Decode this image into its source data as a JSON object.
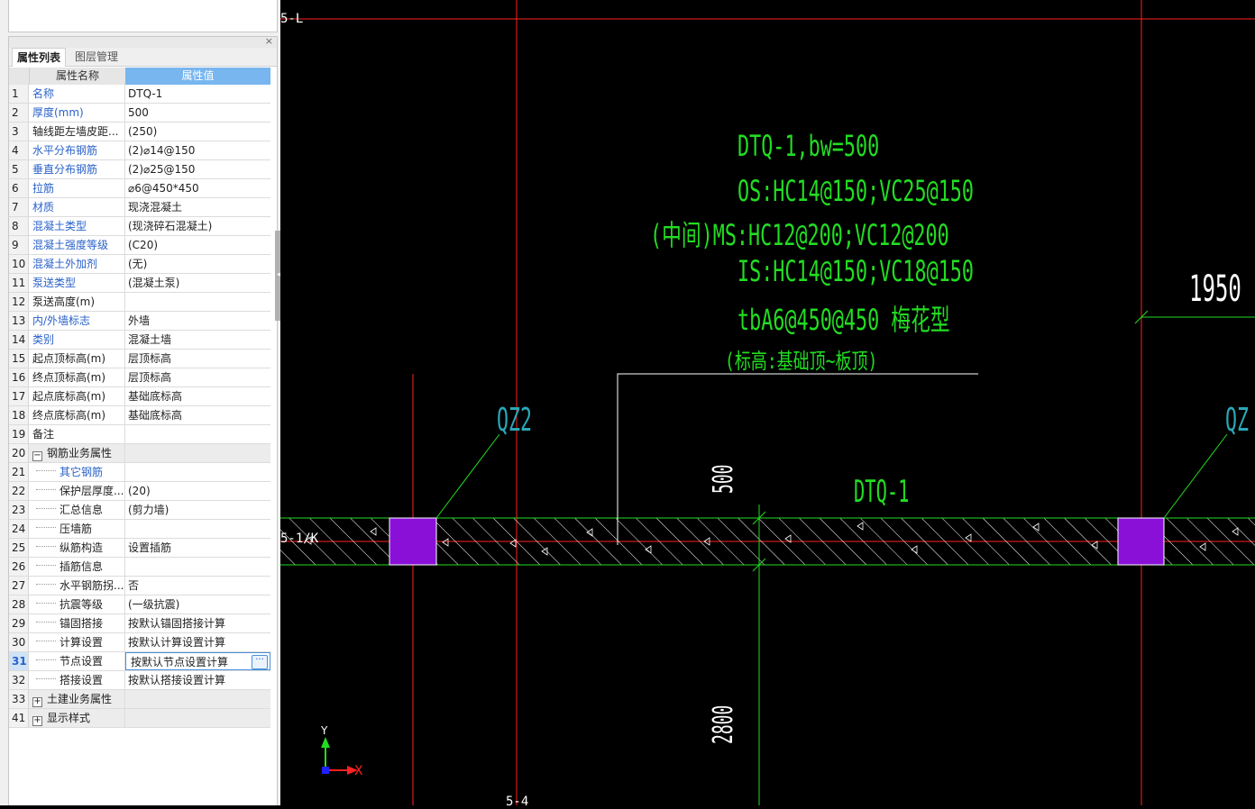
{
  "left_panel": {
    "tabs": [
      "属性列表",
      "图层管理"
    ],
    "close_icon": "close-icon",
    "columns": [
      "属性名称",
      "属性值"
    ],
    "rows": [
      {
        "num": "1",
        "name": "名称",
        "value": "DTQ-1"
      },
      {
        "num": "2",
        "name": "厚度(mm)",
        "value": "500"
      },
      {
        "num": "3",
        "name": "轴线距左墙皮距...",
        "value": "(250)"
      },
      {
        "num": "4",
        "name": "水平分布钢筋",
        "value": "(2)⌀14@150"
      },
      {
        "num": "5",
        "name": "垂直分布钢筋",
        "value": "(2)⌀25@150"
      },
      {
        "num": "6",
        "name": "拉筋",
        "value": "⌀6@450*450"
      },
      {
        "num": "7",
        "name": "材质",
        "value": "现浇混凝土"
      },
      {
        "num": "8",
        "name": "混凝土类型",
        "value": "(现浇碎石混凝土)"
      },
      {
        "num": "9",
        "name": "混凝土强度等级",
        "value": "(C20)"
      },
      {
        "num": "10",
        "name": "混凝土外加剂",
        "value": "(无)"
      },
      {
        "num": "11",
        "name": "泵送类型",
        "value": "(混凝土泵)"
      },
      {
        "num": "12",
        "name": "泵送高度(m)",
        "value": ""
      },
      {
        "num": "13",
        "name": "内/外墙标志",
        "value": "外墙"
      },
      {
        "num": "14",
        "name": "类别",
        "value": "混凝土墙"
      },
      {
        "num": "15",
        "name": "起点顶标高(m)",
        "value": "层顶标高"
      },
      {
        "num": "16",
        "name": "终点顶标高(m)",
        "value": "层顶标高"
      },
      {
        "num": "17",
        "name": "起点底标高(m)",
        "value": "基础底标高"
      },
      {
        "num": "18",
        "name": "终点底标高(m)",
        "value": "基础底标高"
      },
      {
        "num": "19",
        "name": "备注",
        "value": ""
      },
      {
        "num": "20",
        "name": "钢筋业务属性",
        "value": ""
      },
      {
        "num": "21",
        "name": "其它钢筋",
        "value": ""
      },
      {
        "num": "22",
        "name": "保护层厚度...",
        "value": "(20)"
      },
      {
        "num": "23",
        "name": "汇总信息",
        "value": "(剪力墙)"
      },
      {
        "num": "24",
        "name": "压墙筋",
        "value": ""
      },
      {
        "num": "25",
        "name": "纵筋构造",
        "value": "设置插筋"
      },
      {
        "num": "26",
        "name": "插筋信息",
        "value": ""
      },
      {
        "num": "27",
        "name": "水平钢筋拐...",
        "value": "否"
      },
      {
        "num": "28",
        "name": "抗震等级",
        "value": "(一级抗震)"
      },
      {
        "num": "29",
        "name": "锚固搭接",
        "value": "按默认锚固搭接计算"
      },
      {
        "num": "30",
        "name": "计算设置",
        "value": "按默认计算设置计算"
      },
      {
        "num": "31",
        "name": "节点设置",
        "value": "按默认节点设置计算"
      },
      {
        "num": "32",
        "name": "搭接设置",
        "value": "按默认搭接设置计算"
      },
      {
        "num": "33",
        "name": "土建业务属性",
        "value": ""
      },
      {
        "num": "41",
        "name": "显示样式",
        "value": ""
      }
    ],
    "ellipsis_button": "···"
  },
  "cad": {
    "axis_labels": [
      "5-L",
      "5-1/K",
      "5-4"
    ],
    "annotation": {
      "line1": "DTQ-1,bw=500",
      "line2": "OS:HC14@150;VC25@150",
      "line3": "(中间)MS:HC12@200;VC12@200",
      "line4": "IS:HC14@150;VC18@150",
      "line5": "tbA6@450@450 梅花型",
      "line6": "(标高:基础顶~板顶)"
    },
    "column_labels": [
      "QZ2",
      "QZ"
    ],
    "wall_label": "DTQ-1",
    "dimensions": [
      "500",
      "2800",
      "1950"
    ],
    "ucs": {
      "y": "Y",
      "x": "X"
    },
    "colors": {
      "background": "#000000",
      "axis_line": "#ff2020",
      "green_text": "#22dd22",
      "cyan_text": "#2aa8b8",
      "column_fill": "#8a10d8",
      "white": "#ffffff"
    }
  }
}
